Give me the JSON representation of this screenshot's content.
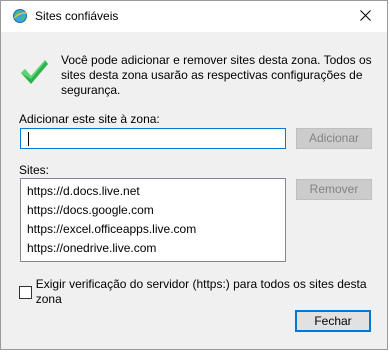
{
  "window": {
    "title": "Sites confiáveis",
    "title_icon": "internet-globe-icon",
    "close_icon": "close-icon"
  },
  "info": {
    "icon": "green-check-icon",
    "text": "Você pode adicionar e remover sites desta zona. Todos os sites desta zona usarão as respectivas configurações de segurança."
  },
  "add_site": {
    "label": "Adicionar este site à zona:",
    "value": "",
    "button_label": "Adicionar"
  },
  "sites": {
    "label": "Sites:",
    "items": [
      "https://d.docs.live.net",
      "https://docs.google.com",
      "https://excel.officeapps.live.com",
      "https://onedrive.live.com"
    ],
    "remove_label": "Remover"
  },
  "server_verification": {
    "label": "Exigir verificação do servidor (https:) para todos os sites desta zona",
    "checked": false
  },
  "footer": {
    "close_label": "Fechar"
  },
  "colors": {
    "accent": "#0078d7",
    "check_green": "#2db34a"
  }
}
